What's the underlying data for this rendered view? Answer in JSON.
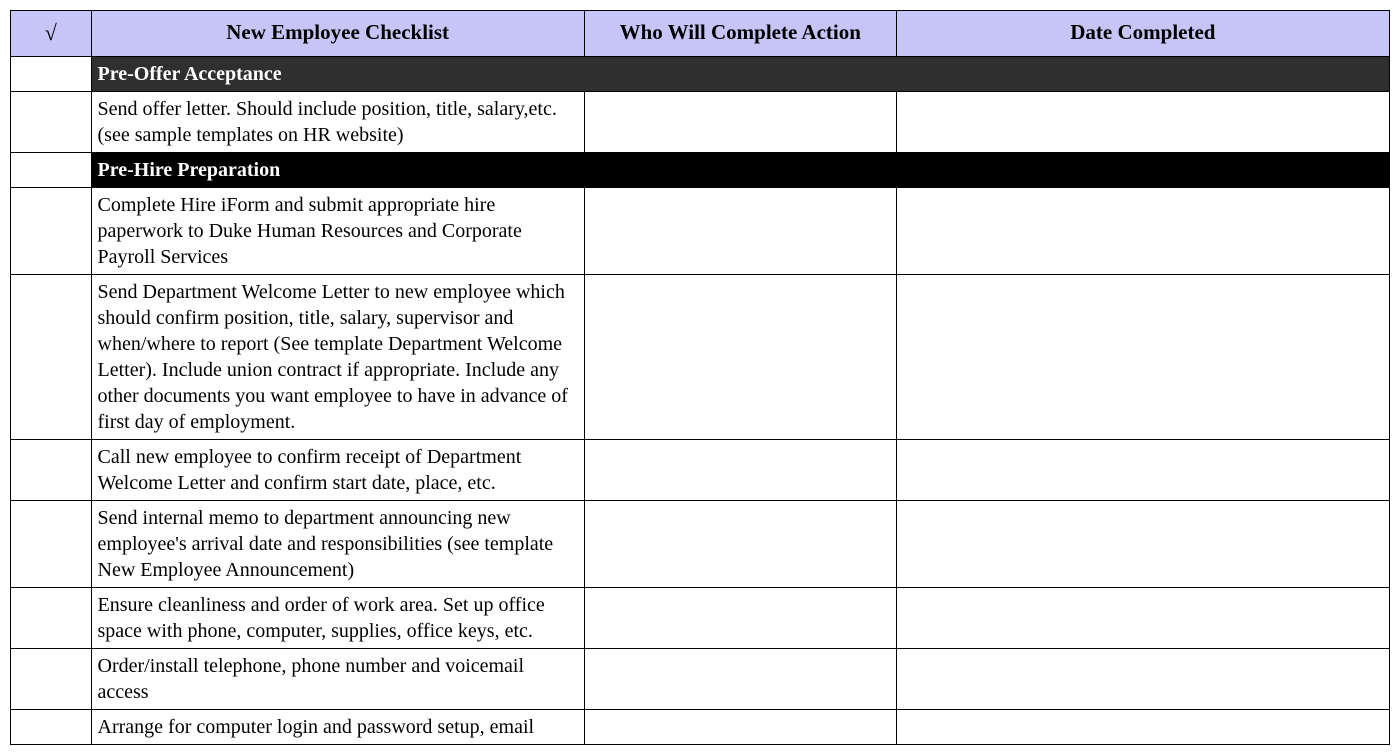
{
  "headers": {
    "check": "√",
    "task": "New Employee Checklist",
    "who": "Who Will Complete Action",
    "date": "Date Completed"
  },
  "sections": [
    {
      "title": "Pre-Offer Acceptance",
      "style": "dark",
      "items": [
        {
          "task": "Send offer letter. Should include position, title, salary,etc. (see sample templates on HR website)",
          "who": "",
          "date": ""
        }
      ]
    },
    {
      "title": "Pre-Hire Preparation",
      "style": "black",
      "items": [
        {
          "task": "Complete Hire iForm and submit appropriate hire paperwork to Duke Human Resources and Corporate Payroll Services",
          "who": "",
          "date": ""
        },
        {
          "task": "Send Department Welcome Letter to new employee which should confirm position, title, salary, supervisor and when/where to report (See template Department Welcome Letter). Include union contract if appropriate. Include any other documents you want employee to have in advance of first day of employment.",
          "who": "",
          "date": ""
        },
        {
          "task": "Call new employee to confirm receipt of Department Welcome Letter and confirm start date, place, etc.",
          "who": "",
          "date": ""
        },
        {
          "task": "Send internal memo to department announcing new employee's arrival date and responsibilities (see template New Employee Announcement)",
          "who": "",
          "date": ""
        },
        {
          "task": "Ensure cleanliness and order of work area. Set up office space with phone, computer, supplies, office keys, etc.",
          "who": "",
          "date": ""
        },
        {
          "task": "Order/install telephone, phone number and voicemail access",
          "who": "",
          "date": ""
        },
        {
          "task": "Arrange for computer login and password setup, email",
          "who": "",
          "date": ""
        }
      ]
    }
  ]
}
